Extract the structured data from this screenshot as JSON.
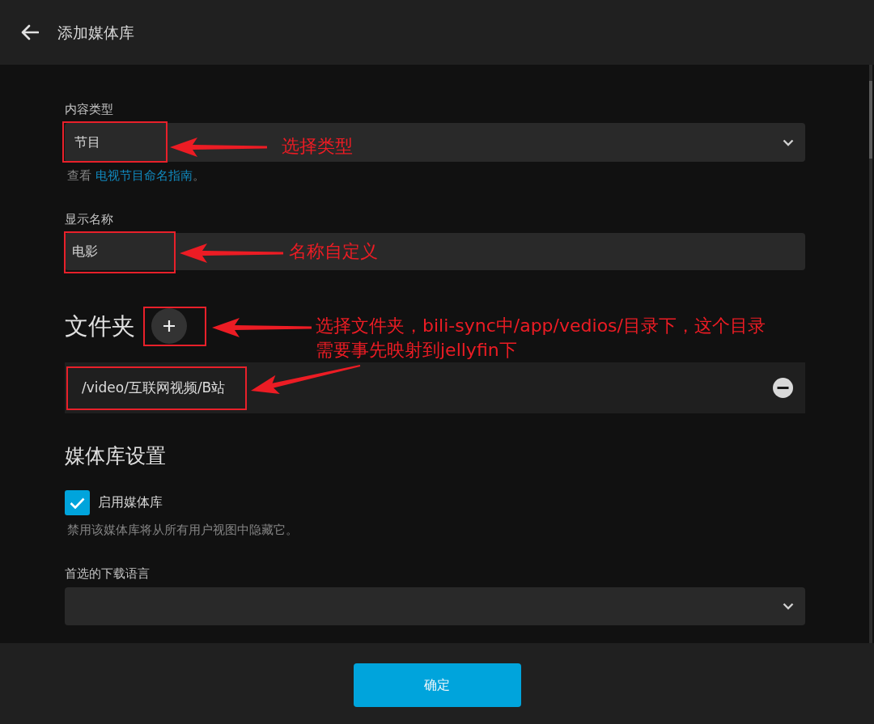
{
  "header": {
    "title": "添加媒体库"
  },
  "content_type": {
    "label": "内容类型",
    "value": "节目",
    "help": {
      "before": "查看",
      "link": "电视节目命名指南",
      "after": "。"
    },
    "annotation": "选择类型"
  },
  "display_name": {
    "label": "显示名称",
    "value": "电影",
    "annotation": "名称自定义"
  },
  "folders": {
    "title": "文件夹",
    "annotation": "选择文件夹，bili-sync中/app/vedios/目录下，这个目录需要事先映射到jellyfin下",
    "paths": [
      {
        "path": "/video/互联网视频/B站",
        "highlighted": true
      }
    ]
  },
  "library_settings": {
    "title": "媒体库设置",
    "enable": {
      "label": "启用媒体库",
      "checked": true,
      "help": "禁用该媒体库将从所有用户视图中隐藏它。"
    },
    "download_language": {
      "label": "首选的下载语言"
    }
  },
  "footer": {
    "confirm_button": "确定"
  }
}
